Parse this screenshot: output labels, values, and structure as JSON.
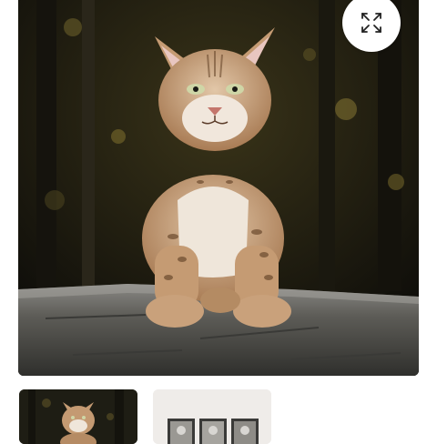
{
  "gallery": {
    "main_image": {
      "subject": "lynx-kitten-on-rock",
      "background_color": "#1c1a12",
      "rock_color": "#5d5c57",
      "fur_color": "#c49a72"
    },
    "expand_button": {
      "icon": "expand-arrows-icon"
    },
    "thumbnails": [
      {
        "subject": "lynx-kitten-photo",
        "selected": true
      },
      {
        "subject": "framed-prints-on-wall",
        "selected": false
      }
    ]
  }
}
